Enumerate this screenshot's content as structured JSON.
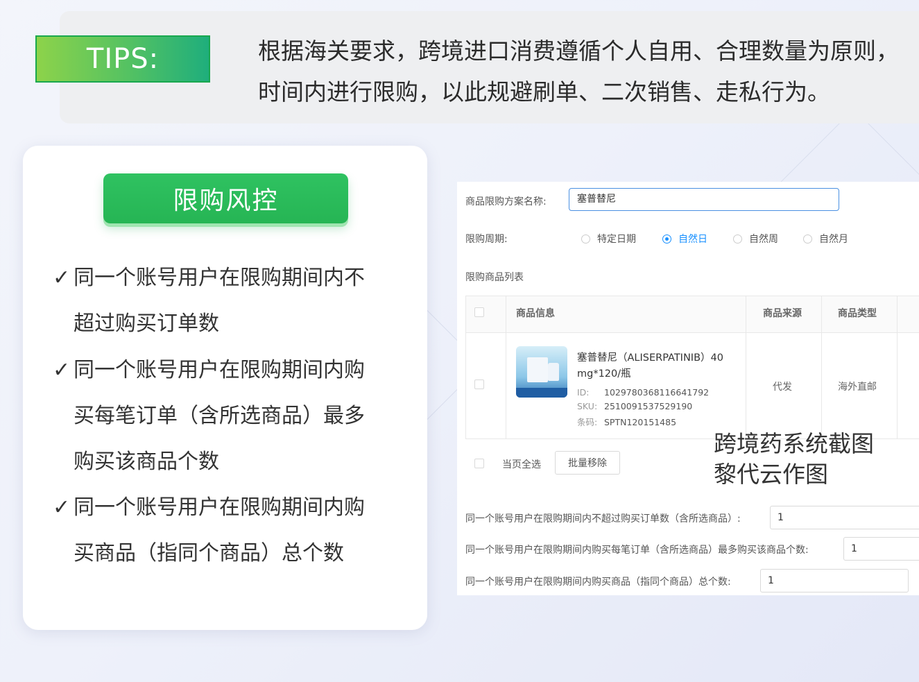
{
  "tips": {
    "badge": "TIPS:",
    "line1": "根据海关要求，跨境进口消费遵循个人自用、合理数量为原则，",
    "line2": "时间内进行限购，以此规避刷单、二次销售、走私行为。"
  },
  "card": {
    "title": "限购风控",
    "check": "✓",
    "rules": [
      [
        "同一个账号用户在限购期间内不",
        "超过购买订单数"
      ],
      [
        "同一个账号用户在限购期间内购",
        "买每笔订单（含所选商品）最多",
        "购买该商品个数"
      ],
      [
        "同一个账号用户在限购期间内购",
        "买商品（指同个商品）总个数"
      ]
    ]
  },
  "panel": {
    "plan_name_label": "商品限购方案名称:",
    "plan_name_value": "塞普替尼",
    "period_label": "限购周期:",
    "period_options": [
      "特定日期",
      "自然日",
      "自然周",
      "自然月"
    ],
    "period_selected": "自然日",
    "list_label": "限购商品列表",
    "columns": [
      "商品信息",
      "商品来源",
      "商品类型"
    ],
    "product": {
      "name": "塞普替尼（ALISERPATINIB）40 mg*120/瓶",
      "id_key": "ID:",
      "id": "1029780368116641792",
      "sku_key": "SKU:",
      "sku": "2510091537529190",
      "barcode_key": "条码:",
      "barcode": "SPTN120151485",
      "source": "代发",
      "type": "海外直邮"
    },
    "select_all": "当页全选",
    "batch_remove": "批量移除",
    "limits": [
      {
        "label": "同一个账号用户在限购期间内不超过购买订单数（含所选商品）:",
        "value": "1"
      },
      {
        "label": "同一个账号用户在限购期间内购买每笔订单（含所选商品）最多购买该商品个数:",
        "value": "1"
      },
      {
        "label": "同一个账号用户在限购期间内购买商品（指同个商品）总个数:",
        "value": "1"
      }
    ]
  },
  "watermark": {
    "line1": "跨境药系统截图",
    "line2": "黎代云作图"
  }
}
